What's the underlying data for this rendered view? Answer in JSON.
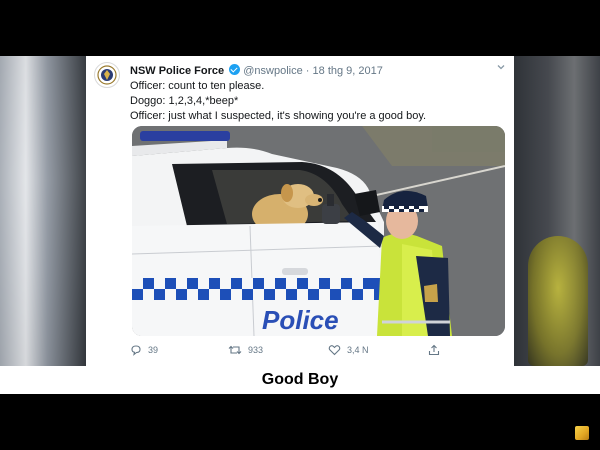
{
  "tweet": {
    "name": "NSW Police Force",
    "handle": "@nswpolice",
    "separator": "·",
    "date": "18 thg 9, 2017",
    "lines": [
      "Officer: count to ten please.",
      "Doggo: 1,2,3,4,*beep*",
      "Officer: just what I suspected, it's showing you're a good boy."
    ],
    "photo_text": "Police",
    "actions": {
      "replies": "39",
      "retweets": "933",
      "likes": "3,4 N"
    }
  },
  "caption": "Good Boy",
  "icons": {
    "avatar": "nsw-police-badge-icon",
    "verified": "verified-badge-icon",
    "menu": "chevron-down-icon",
    "reply": "reply-icon",
    "retweet": "retweet-icon",
    "like": "heart-icon",
    "share": "share-icon",
    "corner": "channel-logo-icon"
  },
  "colors": {
    "twitter_blue": "#1da1f2",
    "police_blue": "#1d4fb8",
    "vest_yellow": "#c9e33a"
  }
}
